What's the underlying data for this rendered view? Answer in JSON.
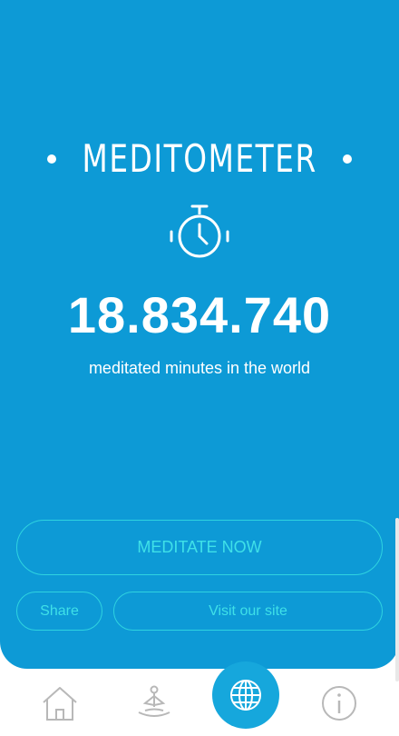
{
  "app": {
    "title": "MEDITOMETER",
    "counter_value": "18.834.740",
    "counter_label": "meditated minutes in the world"
  },
  "actions": {
    "meditate_label": "MEDITATE NOW",
    "share_label": "Share",
    "visit_label": "Visit our site"
  },
  "nav": {
    "items": [
      {
        "icon": "home-icon"
      },
      {
        "icon": "meditation-pose-icon"
      },
      {
        "icon": "globe-icon",
        "active": true
      },
      {
        "icon": "info-icon"
      }
    ]
  },
  "colors": {
    "background": "#0d9ad6",
    "accent": "#2fd3e0",
    "nav_active": "#16a7dc",
    "nav_icon": "#b8b8b8"
  }
}
